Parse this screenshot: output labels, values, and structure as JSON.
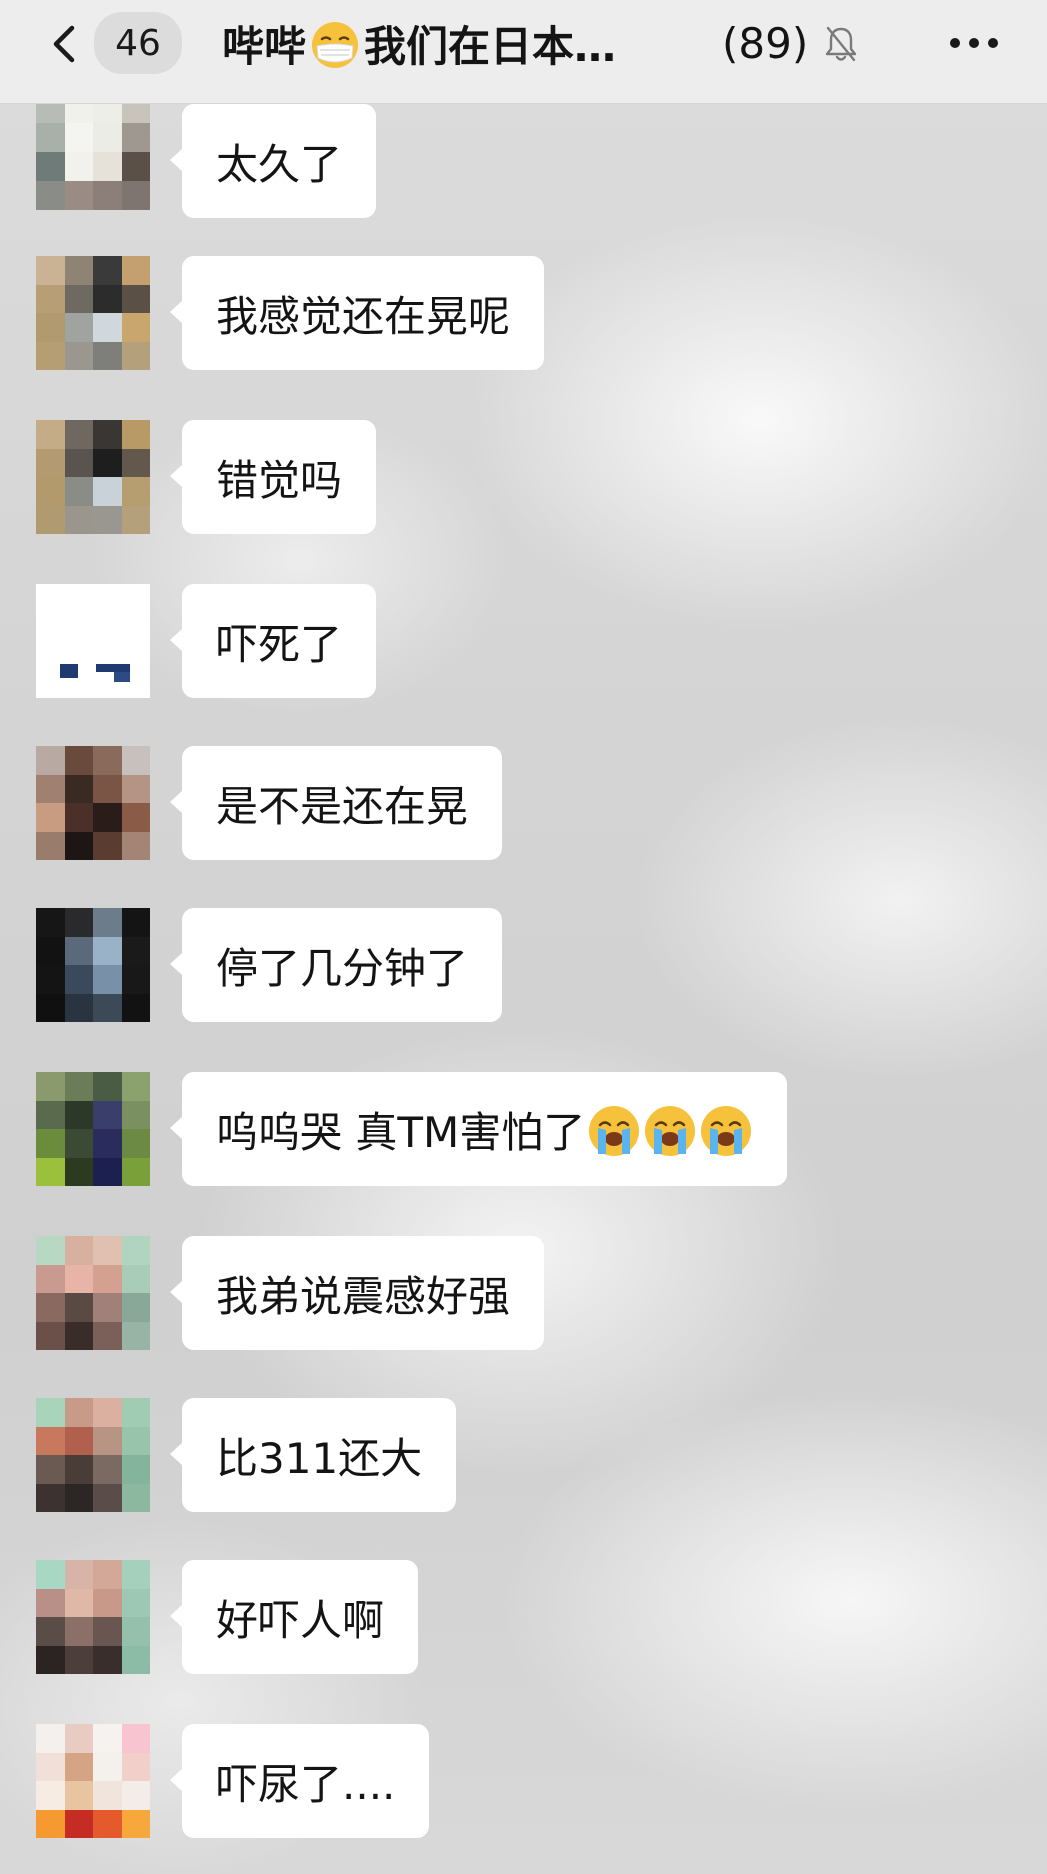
{
  "header": {
    "unread_count": "46",
    "title_part1": "哔哔",
    "title_part2": "我们在日本…",
    "member_count": "(89)"
  },
  "messages": [
    {
      "text": "太久了"
    },
    {
      "text": "我感觉还在晃呢"
    },
    {
      "text": "错觉吗"
    },
    {
      "text": "吓死了"
    },
    {
      "text": "是不是还在晃"
    },
    {
      "text": "停了几分钟了"
    },
    {
      "text": "呜呜哭 真TM害怕了"
    },
    {
      "text": "我弟说震感好强"
    },
    {
      "text": "比311还大"
    },
    {
      "text": "好吓人啊"
    },
    {
      "text": "吓尿了...."
    }
  ],
  "icons": {
    "back": "chevron-left-icon",
    "mute": "bell-off-icon",
    "more": "more-dots-icon",
    "title_emoji": "face-with-medical-mask-emoji",
    "cry_emoji": "loudly-crying-face-emoji"
  },
  "colors": {
    "header_bg": "#ededed",
    "bubble_bg": "#ffffff",
    "text": "#141414"
  }
}
